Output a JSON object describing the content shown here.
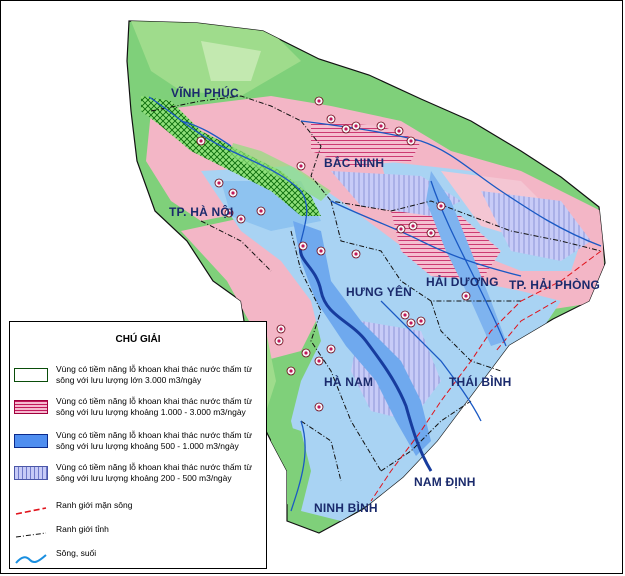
{
  "map": {
    "regions": [
      {
        "name": "VĨNH PHÚC"
      },
      {
        "name": "BẮC NINH"
      },
      {
        "name": "TP. HÀ NỘI"
      },
      {
        "name": "HƯNG YÊN"
      },
      {
        "name": "HẢI DƯƠNG"
      },
      {
        "name": "TP. HẢI PHÒNG"
      },
      {
        "name": "HÀ NAM"
      },
      {
        "name": "THÁI BÌNH"
      },
      {
        "name": "NAM ĐỊNH"
      },
      {
        "name": "NINH BÌNH"
      }
    ],
    "colors": {
      "base_green": "#7fd07a",
      "pink": "#f3b6c6",
      "light_blue": "#a9d3f3",
      "mid_blue": "#6fa9ee",
      "river": "#1a59c4",
      "province_border": "#111111",
      "salinity_border": "#e0121b",
      "label": "#1a2a6c"
    }
  },
  "legend": {
    "title": "CHÚ GIẢI",
    "items": [
      {
        "text": "Vùng có tiềm năng lỗ khoan khai thác nước thấm từ sông với lưu lượng lớn 3.000 m3/ngày",
        "swatch": "green-crosshatch"
      },
      {
        "text": "Vùng có tiềm năng lỗ khoan khai thác nước thấm từ sông với lưu lượng khoảng 1.000 - 3.000 m3/ngày",
        "swatch": "pink-stripes"
      },
      {
        "text": "Vùng có tiềm năng lỗ khoan khai thác nước thấm từ sông với lưu lượng khoảng 500 - 1.000 m3/ngày",
        "swatch": "blue-solid"
      },
      {
        "text": "Vùng có tiềm năng lỗ khoan khai thác nước thấm từ sông với lưu lượng khoảng 200 - 500 m3/ngày",
        "swatch": "lavender-stripes"
      },
      {
        "text": "Ranh giới mặn sông",
        "swatch": "red-dash-line"
      },
      {
        "text": "Ranh giới tỉnh",
        "swatch": "black-dash-line"
      },
      {
        "text": "Sông, suối",
        "swatch": "blue-wavy-line"
      }
    ]
  }
}
